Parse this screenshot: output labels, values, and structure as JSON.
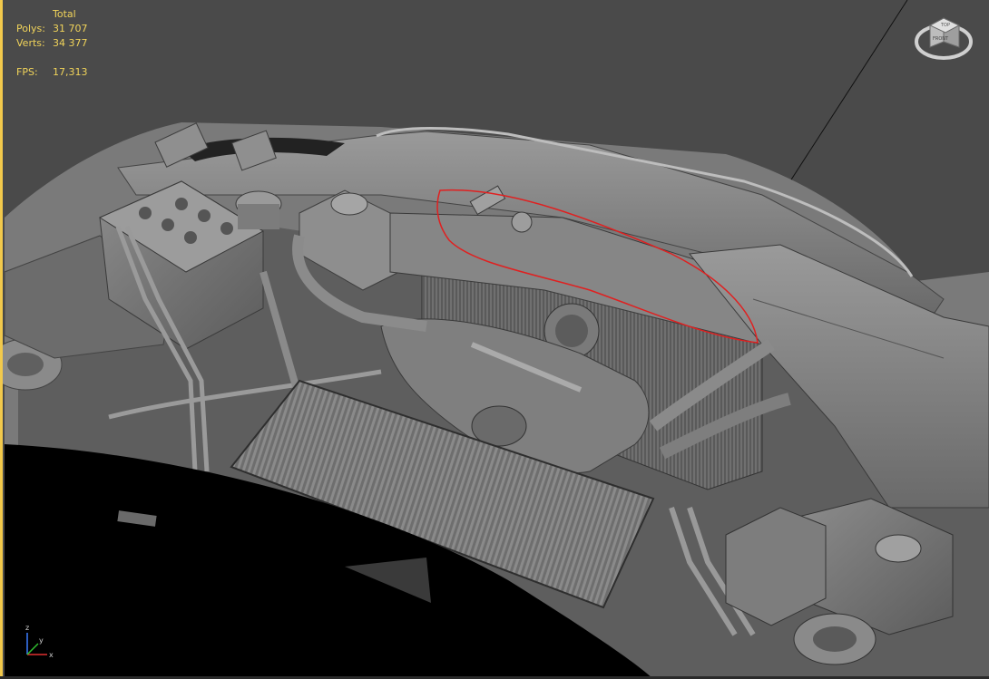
{
  "stats": {
    "header": "Total",
    "polys_label": "Polys:",
    "polys_value": "31 707",
    "verts_label": "Verts:",
    "verts_value": "34 377",
    "fps_label": "FPS:",
    "fps_value": "17,313"
  },
  "viewcube": {
    "top_label": "TOP",
    "front_label": "FRONT"
  },
  "axes": {
    "x_label": "x",
    "y_label": "y",
    "z_label": "z"
  },
  "colors": {
    "stats_text": "#f0d35a",
    "viewport_background": "#4a4a4a",
    "annotation_stroke": "#e02020",
    "viewport_border": "#f2c94c"
  }
}
